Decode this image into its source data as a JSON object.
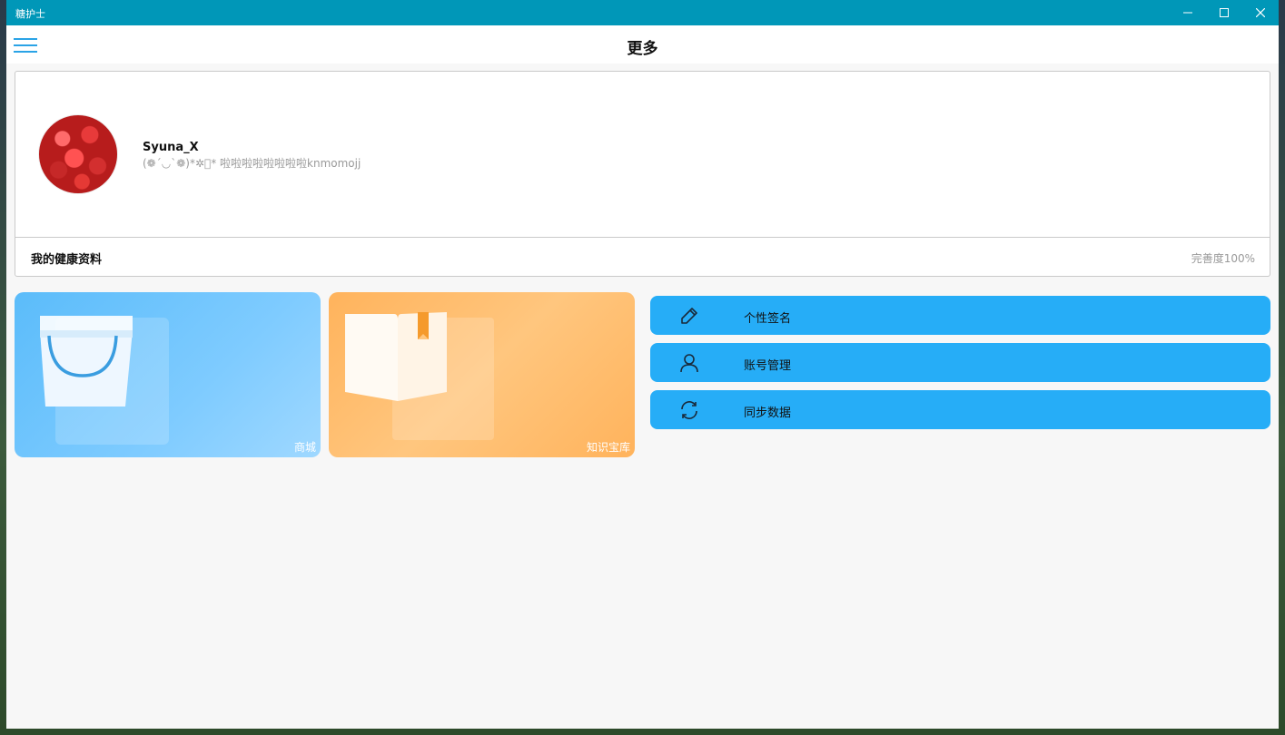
{
  "window": {
    "title": "糖护士",
    "controls": [
      "minimize-icon",
      "maximize-icon",
      "close-icon"
    ]
  },
  "header": {
    "title": "更多",
    "menu_icon": "hamburger-menu-icon"
  },
  "profile": {
    "username": "Syuna_X",
    "signature": "(❁´◡`❁)*✲ﾟ*   啦啦啦啦啦啦啦啦knmomojj",
    "health_label": "我的健康资料",
    "completion": "完善度100%"
  },
  "tiles": [
    {
      "label": "商城",
      "icon": "shopping-bag-icon",
      "color": "#5bbcfa"
    },
    {
      "label": "知识宝库",
      "icon": "open-book-icon",
      "color": "#ffb35c"
    }
  ],
  "actions": [
    {
      "label": "个性签名",
      "icon": "pencil-icon"
    },
    {
      "label": "账号管理",
      "icon": "user-icon"
    },
    {
      "label": "同步数据",
      "icon": "sync-icon"
    }
  ],
  "colors": {
    "titlebar": "#0097b8",
    "accent": "#26adf7",
    "page_bg": "#f7f7f7"
  }
}
